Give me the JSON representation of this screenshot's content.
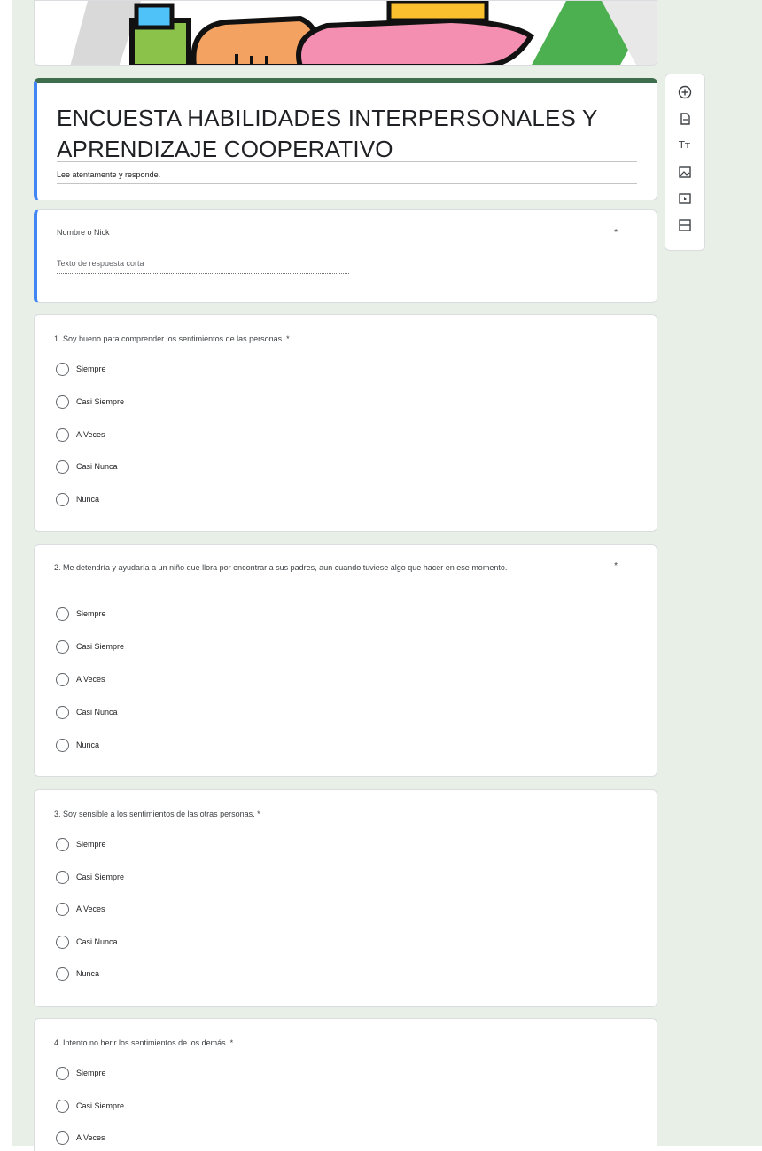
{
  "form": {
    "title": "ENCUESTA HABILIDADES INTERPERSONALES Y APRENDIZAJE COOPERATIVO",
    "description": "Lee atentamente y responde."
  },
  "name_question": {
    "label": "Nombre o Nick",
    "required_mark": "*",
    "placeholder": "Texto de respuesta corta"
  },
  "questions": [
    {
      "label": "1.  Soy bueno para comprender los sentimientos de las personas. *",
      "options": [
        "Siempre",
        "Casi Siempre",
        "A Veces",
        "Casi Nunca",
        "Nunca"
      ]
    },
    {
      "label": "2.  Me detendría y ayudaría a un niño que llora por encontrar a sus padres, aun cuando tuviese algo que hacer en ese momento.",
      "required_mark": "*",
      "options": [
        "Siempre",
        "Casi Siempre",
        "A Veces",
        "Casi Nunca",
        "Nunca"
      ]
    },
    {
      "label": "3.  Soy sensible a los sentimientos de las otras personas. *",
      "options": [
        "Siempre",
        "Casi Siempre",
        "A Veces",
        "Casi Nunca",
        "Nunca"
      ]
    },
    {
      "label": "4.  Intento no herir los sentimientos de los demás. *",
      "options": [
        "Siempre",
        "Casi Siempre",
        "A Veces"
      ]
    }
  ],
  "toolbar": {
    "tools": [
      "add-question-icon",
      "import-questions-icon",
      "add-title-icon",
      "add-image-icon",
      "add-video-icon",
      "add-section-icon"
    ]
  },
  "colors": {
    "theme_accent": "#3e6e4d",
    "focus_border": "#4285f4",
    "background": "#e8efe6"
  }
}
